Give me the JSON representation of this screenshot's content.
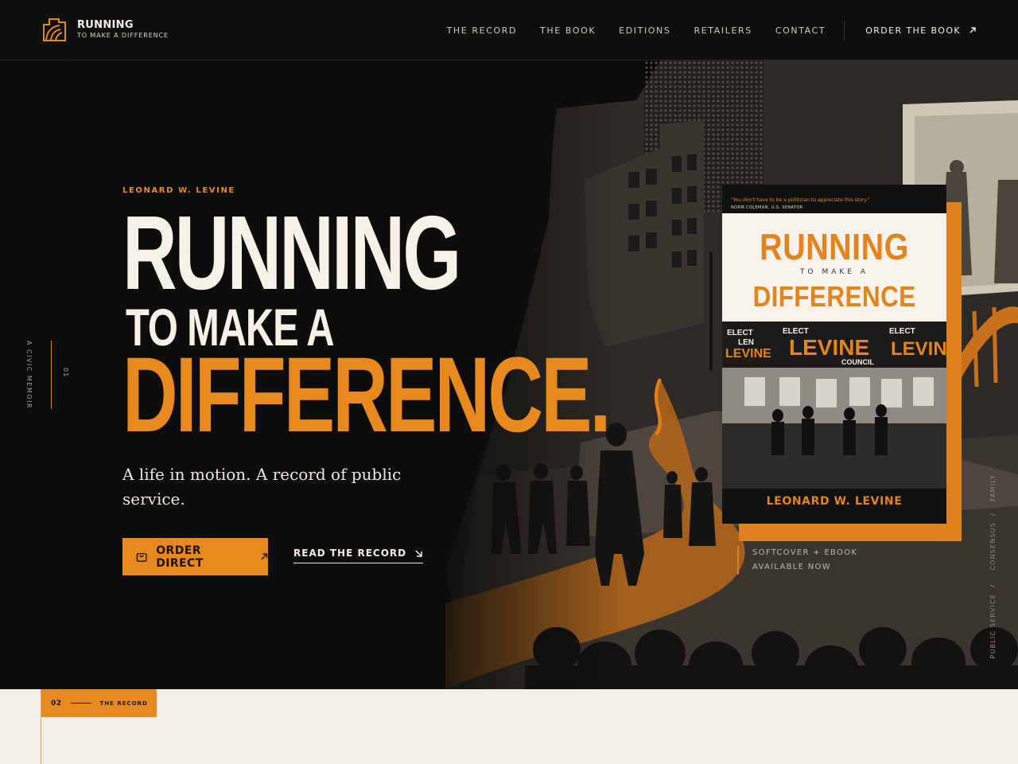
{
  "brand": {
    "title": "RUNNING",
    "subtitle": "TO MAKE A DIFFERENCE"
  },
  "nav": {
    "items": [
      {
        "label": "THE RECORD"
      },
      {
        "label": "THE BOOK"
      },
      {
        "label": "EDITIONS"
      },
      {
        "label": "RETAILERS"
      },
      {
        "label": "CONTACT"
      }
    ],
    "cta": "ORDER THE BOOK",
    "cta_icon": "arrow-up-right-icon"
  },
  "hero": {
    "side_label": "A CIVIC MEMOIR",
    "side_number": "01",
    "eyebrow": "LEONARD W. LEVINE",
    "headline_1": "RUNNING",
    "headline_2": "TO MAKE A",
    "headline_3": "DIFFERENCE",
    "headline_dot": ".",
    "tagline": "A life in motion. A record of public service.",
    "primary_button": "ORDER DIRECT",
    "primary_icon": "shopping-bag-icon",
    "secondary_button": "READ THE RECORD",
    "secondary_icon": "arrow-down-right-icon",
    "availability_line1": "SOFTCOVER + EBOOK",
    "availability_line2": "AVAILABLE NOW",
    "themes": [
      "PUBLIC SERVICE",
      "CONSENSUS",
      "FAMILY"
    ],
    "theme_separator": "/"
  },
  "book": {
    "quote": "\"You don't have to be a politician to appreciate this story.\"",
    "quote_attribution": "NORM COLEMAN, U.S. SENATOR",
    "title_1": "RUNNING",
    "title_2": "TO MAKE A",
    "title_3": "DIFFERENCE",
    "author": "LEONARD W. LEVINE",
    "sign_elect": "ELECT",
    "sign_len": "LEN",
    "sign_name": "LEVINE",
    "sign_council": "COUNCIL"
  },
  "section2": {
    "number": "02",
    "label": "THE RECORD"
  },
  "colors": {
    "accent": "#e8891f",
    "background": "#0e0e0d",
    "cream": "#f3efe5",
    "text": "#f6f1e6"
  }
}
